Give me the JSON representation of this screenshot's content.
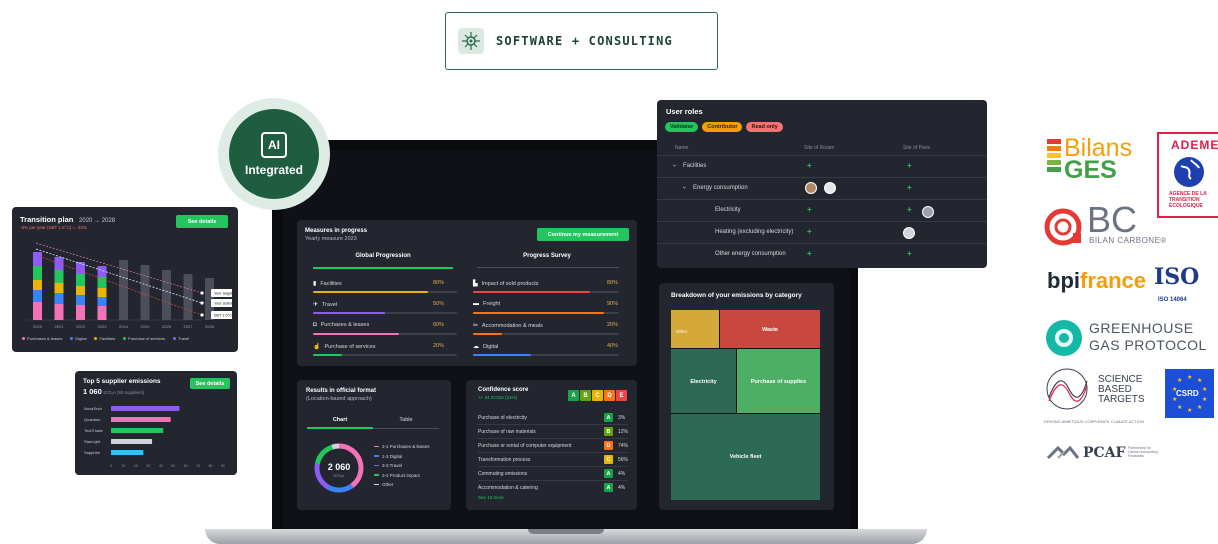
{
  "badge": {
    "text": "SOFTWARE + CONSULTING"
  },
  "ai": {
    "chip": "AI",
    "label": "Integrated"
  },
  "transition": {
    "title": "Transition plan",
    "range": "2020 → 2028",
    "subtitle": "-3% per year (SBT 1.5°C) = -23%",
    "button": "See details",
    "years": [
      "2020",
      "2021",
      "2022",
      "2023",
      "2024",
      "2025",
      "2026",
      "2027",
      "2028"
    ],
    "targets": [
      "Your target",
      "Your actions",
      "SBT 1.5°C"
    ],
    "legend": [
      "Purchases & leases",
      "Digital",
      "Facilities",
      "Purchase of services",
      "Travel"
    ],
    "colors": {
      "purchases": "#f472b6",
      "digital": "#3b82f6",
      "facilities": "#eab308",
      "services": "#22c55e",
      "travel": "#8b5cf6",
      "projected": "#4b4f5c"
    }
  },
  "suppliers": {
    "title": "Top 5 supplier emissions",
    "value": "1 060",
    "unit": "tCO₂e (58 suppliers)",
    "button": "See details",
    "items": [
      {
        "name": "NovaTech",
        "value": 55,
        "color": "#8b5cf6"
      },
      {
        "name": "Quantum",
        "value": 48,
        "color": "#f472b6"
      },
      {
        "name": "TechTrade",
        "value": 42,
        "color": "#22c55e"
      },
      {
        "name": "StarLight",
        "value": 33,
        "color": "#d1d5db"
      },
      {
        "name": "Sapphire",
        "value": 26,
        "color": "#38bdf8"
      }
    ],
    "ticks": [
      "0",
      "10",
      "20",
      "30",
      "40",
      "50",
      "60",
      "70",
      "80",
      "90"
    ]
  },
  "measures": {
    "title": "Measures in progress",
    "subtitle": "Yearly measure 2023",
    "button": "Continue my measurement",
    "tabs": [
      "Global Progression",
      "Progress Survey"
    ],
    "left": [
      {
        "label": "Facilities",
        "pct": "80%",
        "fill": 0.8,
        "color": "#eab308",
        "icon": "building-icon"
      },
      {
        "label": "Travel",
        "pct": "50%",
        "fill": 0.5,
        "color": "#8b5cf6",
        "icon": "plane-icon"
      },
      {
        "label": "Purchases & leases",
        "pct": "60%",
        "fill": 0.6,
        "color": "#f472b6",
        "icon": "bag-icon"
      },
      {
        "label": "Purchase of services",
        "pct": "20%",
        "fill": 0.2,
        "color": "#22c55e",
        "icon": "hand-icon"
      }
    ],
    "right": [
      {
        "label": "Impact of sold products",
        "pct": "80%",
        "fill": 0.8,
        "color": "#ef4444",
        "icon": "factory-icon"
      },
      {
        "label": "Freight",
        "pct": "90%",
        "fill": 0.9,
        "color": "#f97316",
        "icon": "truck-icon"
      },
      {
        "label": "Accommodation & meals",
        "pct": "20%",
        "fill": 0.2,
        "color": "#f97316",
        "icon": "utensils-icon"
      },
      {
        "label": "Digital",
        "pct": "40%",
        "fill": 0.4,
        "color": "#3b82f6",
        "icon": "cloud-icon"
      }
    ]
  },
  "results": {
    "title": "Results in official format",
    "subtitle": "(Location-based approach)",
    "tabs": [
      "Chart",
      "Table"
    ],
    "total": "2 060",
    "unit": "tCO₂e",
    "legend": [
      {
        "label": "2-1 Purchases & leases",
        "color": "#f472b6",
        "share": 0.4
      },
      {
        "label": "1-3 Digital",
        "color": "#3b82f6",
        "share": 0.18
      },
      {
        "label": "3-3 Travel",
        "color": "#8b5cf6",
        "share": 0.2
      },
      {
        "label": "2-4 Product impact",
        "color": "#22c55e",
        "share": 0.17
      },
      {
        "label": "Other",
        "color": "#d1d5db",
        "share": 0.05
      }
    ]
  },
  "confidence": {
    "title": "Confidence score",
    "subtitle": "+/- 34 tCO2e (24%)",
    "scale": [
      "A",
      "B",
      "C",
      "D",
      "E"
    ],
    "scale_colors": [
      "#16a34a",
      "#65a30d",
      "#eab308",
      "#f97316",
      "#ef4444"
    ],
    "rows": [
      {
        "label": "Purchase of electricity",
        "grade": "A",
        "pct": "3%",
        "color": "#16a34a"
      },
      {
        "label": "Purchase of raw materials",
        "grade": "B",
        "pct": "12%",
        "color": "#65a30d"
      },
      {
        "label": "Purchase or rental of computer equipment",
        "grade": "D",
        "pct": "74%",
        "color": "#f97316"
      },
      {
        "label": "Transformation process",
        "grade": "C",
        "pct": "56%",
        "color": "#eab308"
      },
      {
        "label": "Commuting emissions",
        "grade": "A",
        "pct": "4%",
        "color": "#16a34a"
      },
      {
        "label": "Accommodation & catering",
        "grade": "A",
        "pct": "4%",
        "color": "#16a34a"
      }
    ],
    "link": "See 10 more"
  },
  "user_roles": {
    "title": "User roles",
    "pills": [
      {
        "label": "Validator",
        "color": "#22c55e"
      },
      {
        "label": "Contributor",
        "color": "#f59e0b"
      },
      {
        "label": "Read only",
        "color": "#f87171"
      }
    ],
    "columns": [
      "Name",
      "Site of Rouen",
      "Site of Paris"
    ],
    "rows": [
      {
        "name": "Facilities",
        "indent": 0,
        "chevron": "›"
      },
      {
        "name": "Energy consumption",
        "indent": 1,
        "chevron": "›"
      },
      {
        "name": "Electricity",
        "indent": 2,
        "chevron": ""
      },
      {
        "name": "Heating (excluding electricity)",
        "indent": 2,
        "chevron": ""
      },
      {
        "name": "Other energy consumption",
        "indent": 2,
        "chevron": ""
      }
    ]
  },
  "breakdown": {
    "title": "Breakdown of your emissions by category",
    "cells": [
      {
        "label": "Other",
        "color": "#d4a93a"
      },
      {
        "label": "Waste",
        "color": "#c8473e"
      },
      {
        "label": "Electricity",
        "color": "#2d6a55"
      },
      {
        "label": "Purchase of supplies",
        "color": "#4caf64"
      },
      {
        "label": "Vehicle fleet",
        "color": "#2d6a55"
      }
    ]
  },
  "logos": {
    "bilans_ges": [
      "Bilans",
      "GES"
    ],
    "ademe": [
      "ADEME",
      "AGENCE DE LA",
      "TRANSITION",
      "ÉCOLOGIQUE"
    ],
    "bilan_carbone": [
      "BC",
      "BILAN CARBONE®"
    ],
    "bpifrance": [
      "bpi",
      "france"
    ],
    "iso": [
      "ISO",
      "ISO 14064"
    ],
    "ghg": [
      "GREENHOUSE",
      "GAS PROTOCOL"
    ],
    "sbt": [
      "SCIENCE",
      "BASED",
      "TARGETS",
      "DRIVING AMBITIOUS CORPORATE CLIMATE ACTION"
    ],
    "csrd": "CSRD",
    "pcaf": [
      "PCAF",
      "Partnership for",
      "Carbon Accounting",
      "Financials"
    ]
  }
}
